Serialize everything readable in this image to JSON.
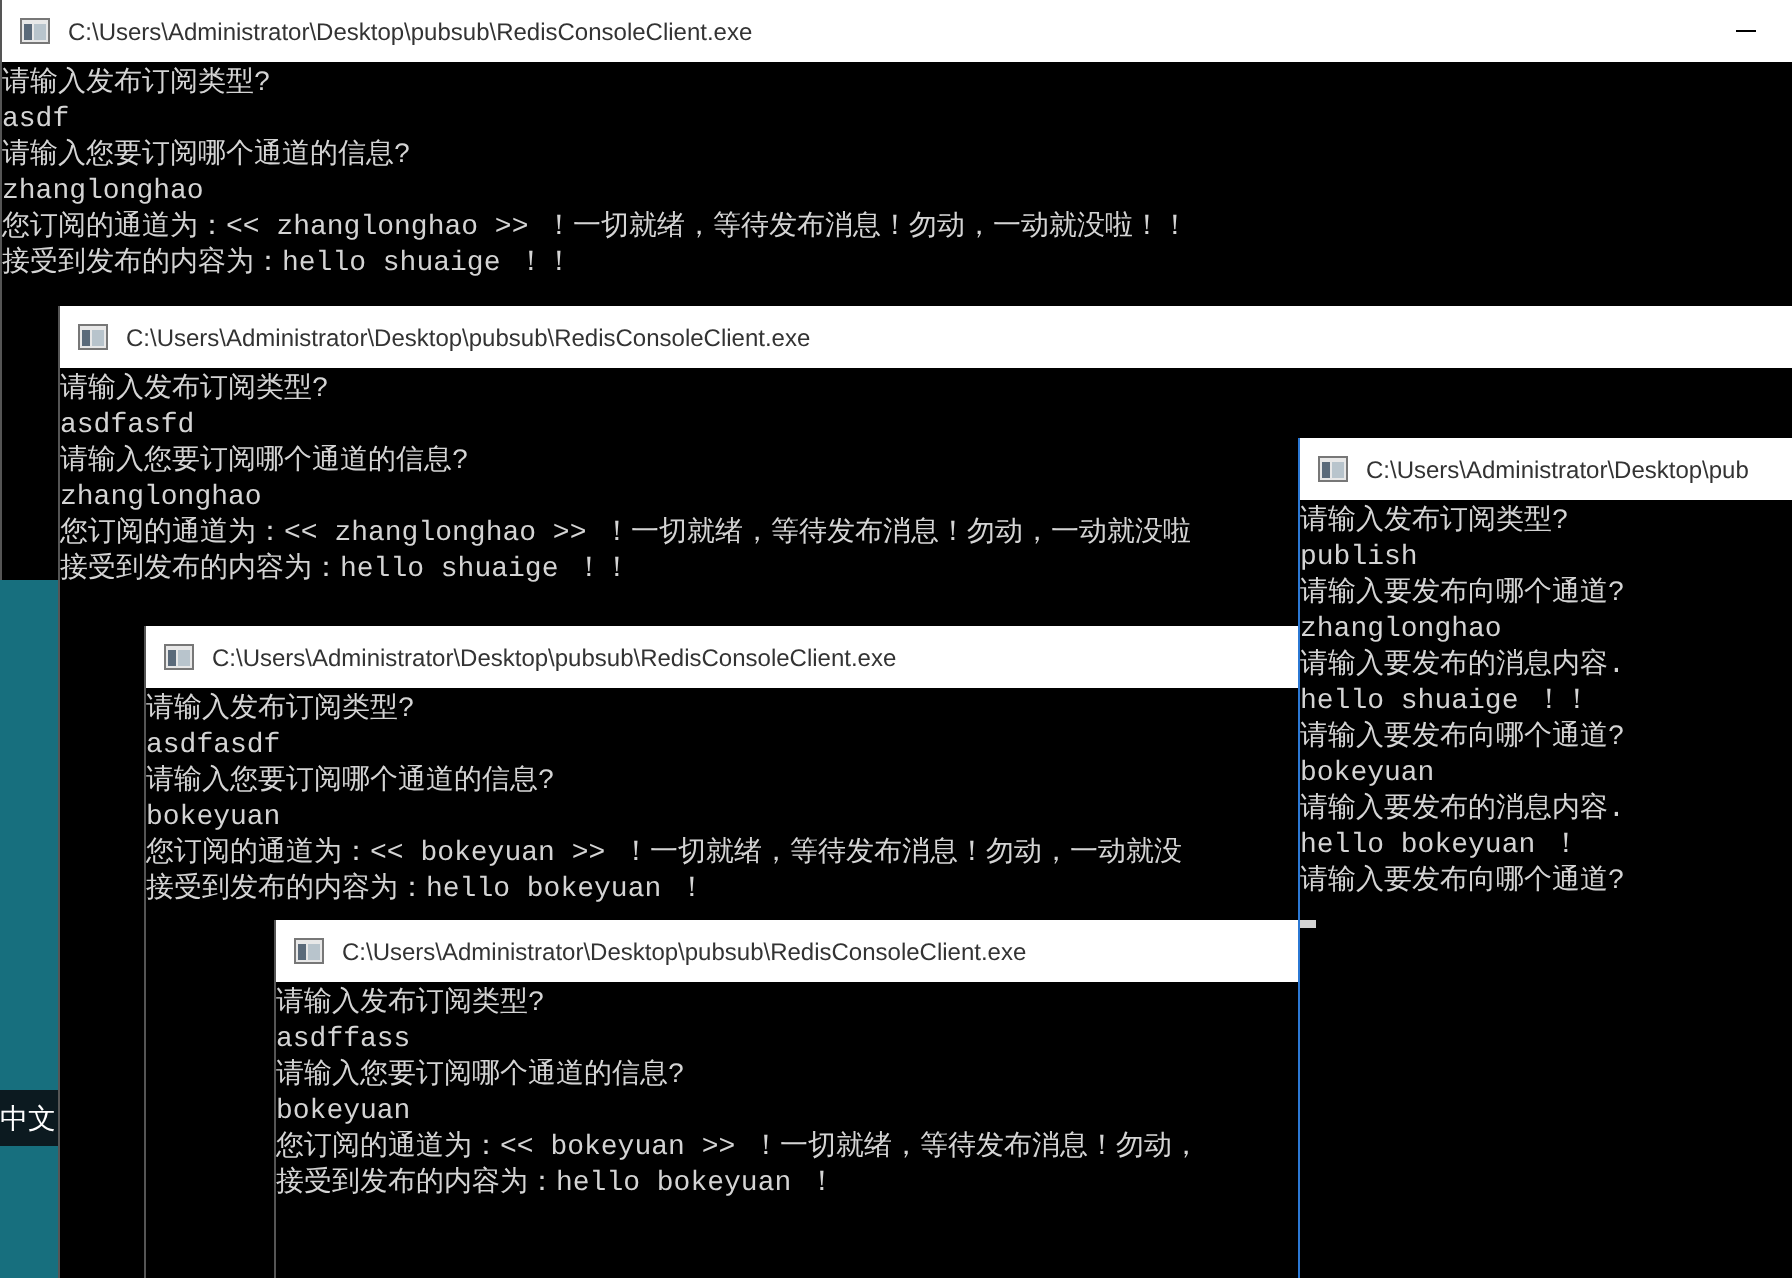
{
  "windows": [
    {
      "title": "C:\\Users\\Administrator\\Desktop\\pubsub\\RedisConsoleClient.exe",
      "active": false,
      "cursor": false,
      "lines": [
        "请输入发布订阅类型?",
        "asdf",
        "请输入您要订阅哪个通道的信息?",
        "zhanglonghao",
        "您订阅的通道为：<< zhanglonghao >> ！一切就绪，等待发布消息！勿动，一动就没啦！！",
        "接受到发布的内容为：hello shuaige ！！"
      ]
    },
    {
      "title": "C:\\Users\\Administrator\\Desktop\\pubsub\\RedisConsoleClient.exe",
      "active": false,
      "cursor": false,
      "lines": [
        "请输入发布订阅类型?",
        "asdfasfd",
        "请输入您要订阅哪个通道的信息?",
        "zhanglonghao",
        "您订阅的通道为：<< zhanglonghao >> ！一切就绪，等待发布消息！勿动，一动就没啦",
        "接受到发布的内容为：hello shuaige ！！"
      ]
    },
    {
      "title": "C:\\Users\\Administrator\\Desktop\\pubsub\\RedisConsoleClient.exe",
      "active": false,
      "cursor": false,
      "lines": [
        "请输入发布订阅类型?",
        "asdfasdf",
        "请输入您要订阅哪个通道的信息?",
        "bokeyuan",
        "您订阅的通道为：<< bokeyuan >> ！一切就绪，等待发布消息！勿动，一动就没",
        "接受到发布的内容为：hello bokeyuan ！"
      ]
    },
    {
      "title": "C:\\Users\\Administrator\\Desktop\\pubsub\\RedisConsoleClient.exe",
      "active": false,
      "cursor": false,
      "lines": [
        "请输入发布订阅类型?",
        "asdffass",
        "请输入您要订阅哪个通道的信息?",
        "bokeyuan",
        "您订阅的通道为：<< bokeyuan >> ！一切就绪，等待发布消息！勿动，",
        "接受到发布的内容为：hello bokeyuan ！"
      ]
    },
    {
      "title": "C:\\Users\\Administrator\\Desktop\\pub",
      "active": true,
      "cursor": true,
      "lines": [
        "请输入发布订阅类型?",
        "publish",
        "请输入要发布向哪个通道?",
        "zhanglonghao",
        "请输入要发布的消息内容.",
        "hello shuaige ！！",
        "请输入要发布向哪个通道?",
        "bokeyuan",
        "请输入要发布的消息内容.",
        "hello bokeyuan ！",
        "请输入要发布向哪个通道?"
      ]
    }
  ],
  "desktop": {
    "language_indicator": "中文"
  }
}
